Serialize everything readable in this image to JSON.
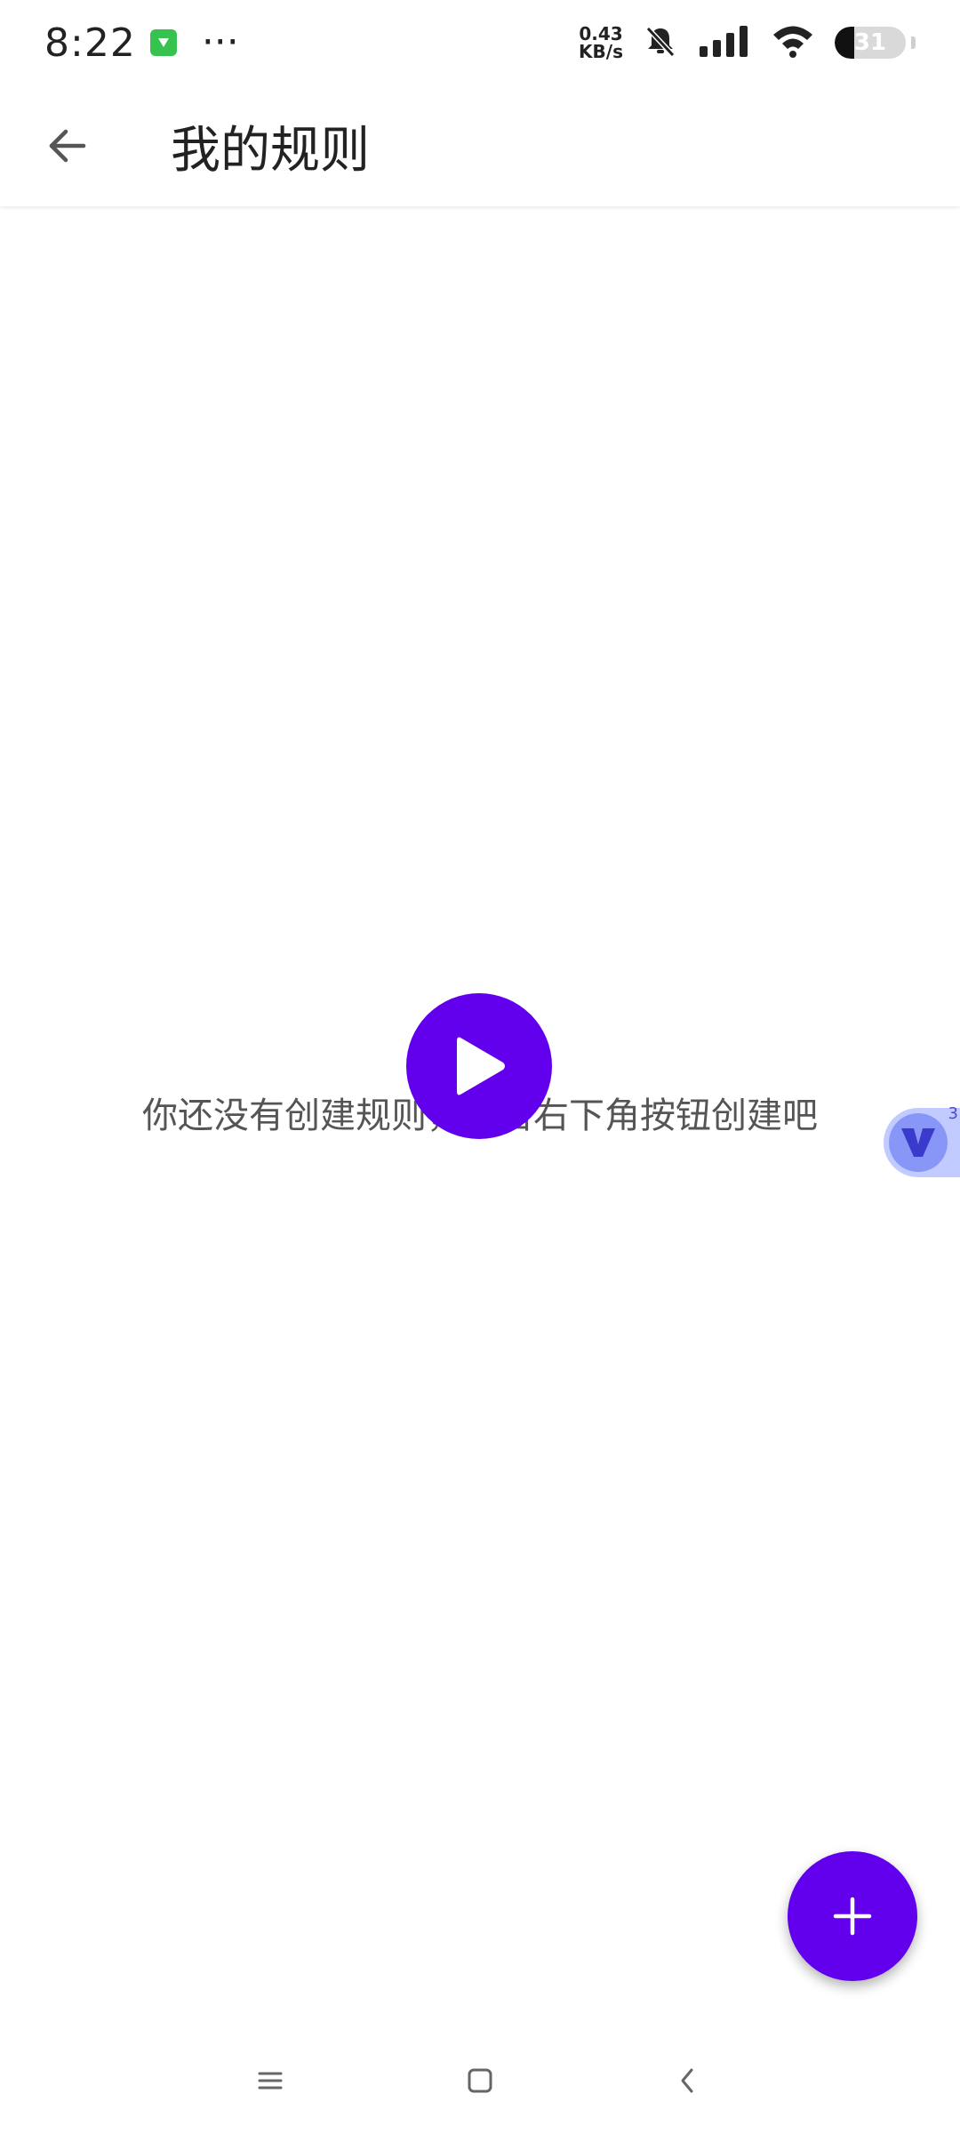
{
  "status_bar": {
    "time": "8:22",
    "more": "···",
    "net_speed_value": "0.43",
    "net_speed_unit": "KB/s",
    "battery": "31",
    "icons": [
      "app-badge-icon",
      "mute-bell-icon",
      "signal-icon",
      "wifi-icon",
      "battery-icon"
    ]
  },
  "app_bar": {
    "title": "我的规则",
    "back_icon": "arrow-left-icon"
  },
  "main": {
    "empty_message": "你还没有创建规则，点击右下角按钮创建吧",
    "play_icon": "play-icon"
  },
  "floating_bubble": {
    "count": "3",
    "icon": "v-logo-icon"
  },
  "fab": {
    "icon": "plus-icon"
  },
  "nav_bar": {
    "icons": [
      "menu-icon",
      "home-icon",
      "back-icon"
    ]
  },
  "colors": {
    "accent": "#6200ee",
    "text_primary": "#222222",
    "text_secondary": "#555555",
    "bubble": "#7a8cff"
  }
}
